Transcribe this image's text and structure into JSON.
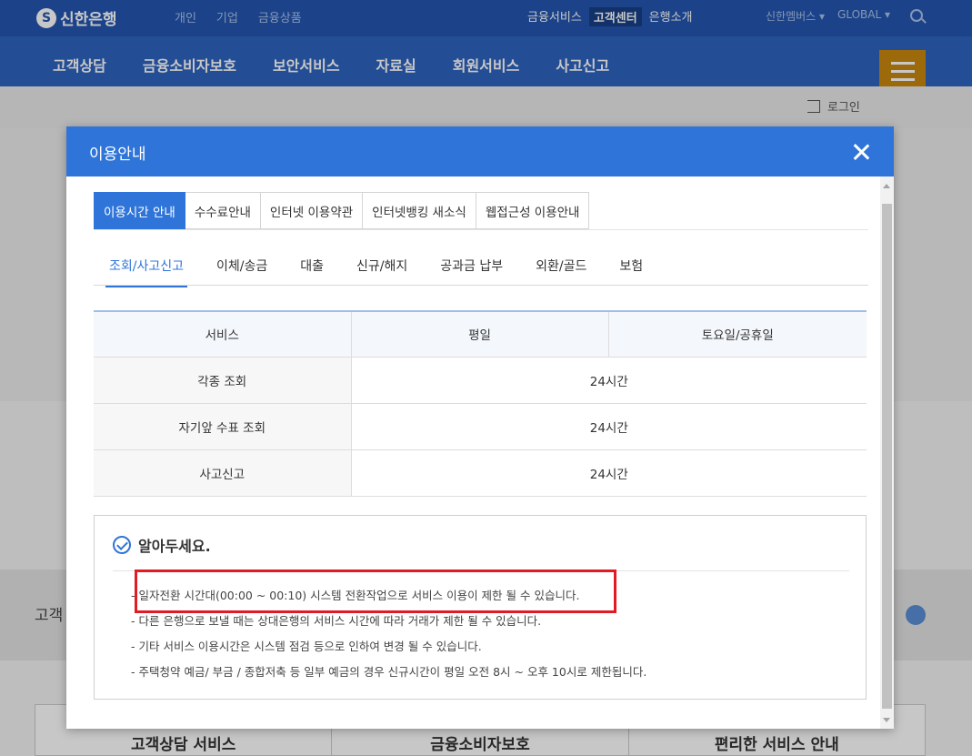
{
  "site": {
    "logo": "신한은행",
    "topnav": [
      "개인",
      "기업",
      "금융상품"
    ],
    "topright": [
      "금융서비스",
      "고객센터",
      "은행소개"
    ],
    "topfar": [
      "신한멤버스 ▾",
      "GLOBAL ▾"
    ],
    "mainnav": [
      "고객상담",
      "금융소비자보호",
      "보안서비스",
      "자료실",
      "회원서비스",
      "사고신고"
    ],
    "login": "로그인",
    "bg_left_text": "고객",
    "bottom_cards": [
      "고객상담 서비스",
      "금융소비자보호",
      "편리한 서비스 안내"
    ]
  },
  "modal": {
    "title": "이용안내",
    "tabs": [
      "이용시간 안내",
      "수수료안내",
      "인터넷 이용약관",
      "인터넷뱅킹 새소식",
      "웹접근성 이용안내"
    ],
    "subtabs": [
      "조회/사고신고",
      "이체/송금",
      "대출",
      "신규/해지",
      "공과금 납부",
      "외환/골드",
      "보험"
    ],
    "table": {
      "headers": [
        "서비스",
        "평일",
        "토요일/공휴일"
      ],
      "rows": [
        {
          "service": "각종 조회",
          "hours": "24시간"
        },
        {
          "service": "자기앞 수표 조회",
          "hours": "24시간"
        },
        {
          "service": "사고신고",
          "hours": "24시간"
        }
      ]
    },
    "notice": {
      "title": "알아두세요.",
      "items": [
        "일자전환 시간대(00:00 ~ 00:10) 시스템 전환작업으로 서비스 이용이 제한 될 수 있습니다.",
        "다른 은행으로 보낼 때는 상대은행의 서비스 시간에 따라 거래가 제한 될 수 있습니다.",
        "기타 서비스 이용시간은 시스템 점검 등으로 인하여 변경 될 수 있습니다.",
        "주택청약 예금/ 부금 / 종합저축 등 일부 예금의 경우 신규시간이 평일 오전 8시 ~ 오후 10시로 제한됩니다."
      ]
    }
  },
  "colors": {
    "header_blue": "#2457b0",
    "modal_blue": "#2e74d9",
    "highlight_red": "#e01b24",
    "menu_gold": "#c9880f"
  }
}
